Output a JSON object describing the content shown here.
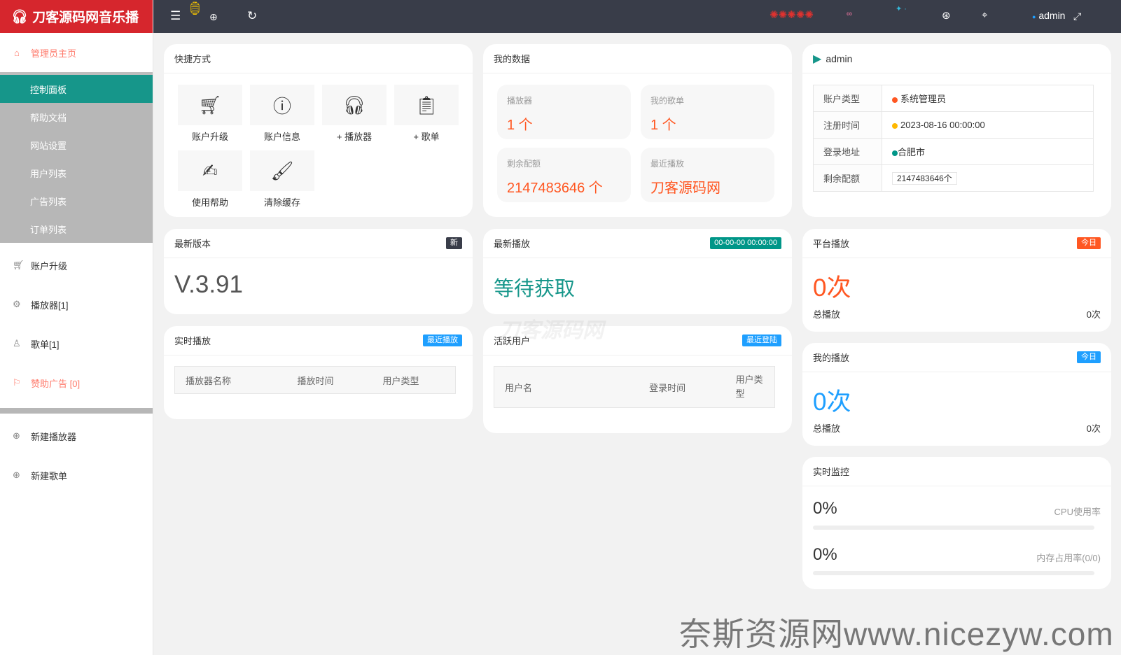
{
  "app": {
    "title": "刀客源码网音乐播"
  },
  "header": {
    "user": "admin"
  },
  "sidebar": {
    "home": "管理员主页",
    "submenu": [
      "控制面板",
      "帮助文档",
      "网站设置",
      "用户列表",
      "广告列表",
      "订单列表"
    ],
    "items": [
      "账户升级",
      "播放器[1]",
      "歌单[1]",
      "赞助广告 [0]"
    ],
    "bottom": [
      "新建播放器",
      "新建歌单"
    ]
  },
  "shortcuts": {
    "title": "快捷方式",
    "items": [
      "账户升级",
      "账户信息",
      "+ 播放器",
      "+ 歌单",
      "使用帮助",
      "清除缓存"
    ]
  },
  "mydata": {
    "title": "我的数据",
    "stats": [
      {
        "label": "播放器",
        "value": "1 个"
      },
      {
        "label": "我的歌单",
        "value": "1 个"
      },
      {
        "label": "剩余配额",
        "value": "2147483646 个"
      },
      {
        "label": "最近播放",
        "value": "刀客源码网"
      }
    ]
  },
  "account": {
    "name": "admin",
    "rows": [
      {
        "key": "账户类型",
        "value": "系统管理员",
        "color": "#ff5722"
      },
      {
        "key": "注册时间",
        "value": "2023-08-16 00:00:00",
        "color": "#ffb800"
      },
      {
        "key": "登录地址",
        "value": "合肥市",
        "color": "#009688"
      },
      {
        "key": "剩余配额",
        "value": "2147483646个",
        "color": ""
      }
    ]
  },
  "version": {
    "title": "最新版本",
    "badge": "新",
    "value": "V.3.91"
  },
  "latest_play": {
    "title": "最新播放",
    "badge": "00-00-00 00:00:00",
    "value": "等待获取"
  },
  "platform": {
    "title": "平台播放",
    "badge": "今日",
    "value": "0次",
    "total_label": "总播放",
    "total_value": "0次"
  },
  "myplay": {
    "title": "我的播放",
    "badge": "今日",
    "value": "0次",
    "total_label": "总播放",
    "total_value": "0次"
  },
  "realtime": {
    "title": "实时播放",
    "badge": "最近播放",
    "columns": [
      "播放器名称",
      "播放时间",
      "用户类型"
    ]
  },
  "active": {
    "title": "活跃用户",
    "badge": "最近登陆",
    "columns": [
      "用户名",
      "登录时间",
      "用户类型"
    ]
  },
  "monitor": {
    "title": "实时监控",
    "cpu_value": "0%",
    "cpu_label": "CPU使用率",
    "cpu_level": 0,
    "mem_value": "0%",
    "mem_label": "内存占用率(0/0)",
    "mem_level": 0
  },
  "watermarks": [
    "刀客源码网",
    "奈斯资源网www.nicezyw.com"
  ],
  "colors": {
    "brand": "#d6262d",
    "teal": "#16968a",
    "orange": "#ff5722",
    "blue": "#1e9fff",
    "header": "#393d49"
  }
}
